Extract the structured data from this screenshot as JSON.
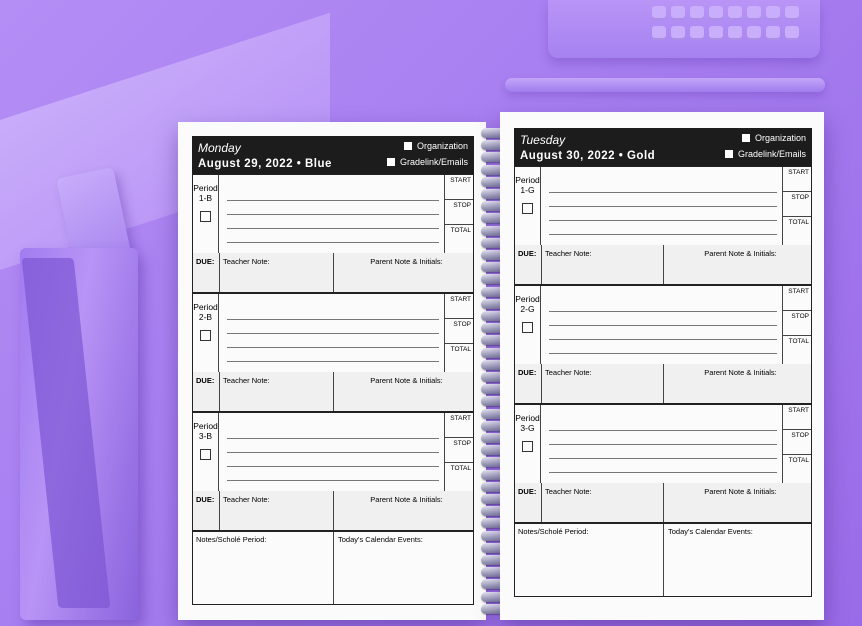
{
  "left_page": {
    "day": "Monday",
    "date": "August 29, 2022 • Blue",
    "options": [
      "Organization",
      "Gradelink/Emails"
    ],
    "periods": [
      {
        "name": "Period",
        "code": "1-B"
      },
      {
        "name": "Period",
        "code": "2-B"
      },
      {
        "name": "Period",
        "code": "3-B"
      }
    ],
    "notes_label": "Notes/Scholé Period:",
    "events_label": "Today's Calendar Events:"
  },
  "right_page": {
    "day": "Tuesday",
    "date": "August 30, 2022 • Gold",
    "options": [
      "Organization",
      "Gradelink/Emails"
    ],
    "periods": [
      {
        "name": "Period",
        "code": "1-G"
      },
      {
        "name": "Period",
        "code": "2-G"
      },
      {
        "name": "Period",
        "code": "3-G"
      }
    ],
    "notes_label": "Notes/Scholé Period:",
    "events_label": "Today's Calendar Events:"
  },
  "labels": {
    "start": "START",
    "stop": "STOP",
    "total": "TOTAL",
    "due": "DUE:",
    "teacher_note": "Teacher Note:",
    "parent_note": "Parent Note & Initials:"
  },
  "colors": {
    "background": "#a77ef0",
    "header": "#1c1c1c"
  }
}
